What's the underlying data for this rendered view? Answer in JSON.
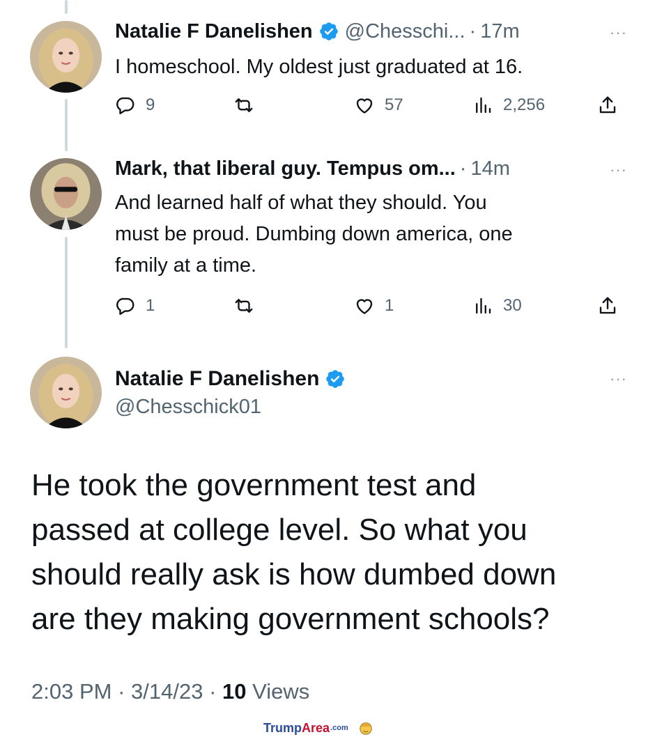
{
  "tweets": [
    {
      "name": "Natalie F Danelishen",
      "handle": "@Chesschi...",
      "separator": "·",
      "time": "17m",
      "more": "···",
      "text": "I homeschool. My oldest just graduated at 16.",
      "stats": {
        "replies": "9",
        "likes": "57",
        "views": "2,256"
      }
    },
    {
      "name": "Mark, that liberal guy. Tempus om...",
      "separator": "·",
      "time": "14m",
      "more": "···",
      "text_lines": [
        "And learned half of what they should. You",
        "must be proud. Dumbing down america, one",
        "family at a time."
      ],
      "stats": {
        "replies": "1",
        "likes": "1",
        "views": "30"
      }
    }
  ],
  "main_tweet": {
    "name": "Natalie F Danelishen",
    "handle": "@Chesschick01",
    "more": "···",
    "text_lines": [
      "He took the government test and",
      "passed at college level. So what you",
      "should really ask is how dumbed down",
      "are they making government schools?"
    ],
    "time": "2:03 PM",
    "separator": "·",
    "date": "3/14/23",
    "views_count": "10",
    "views_label": "Views"
  },
  "icons": {
    "reply": "reply-icon",
    "retweet": "retweet-icon",
    "like": "heart-icon",
    "views": "views-icon",
    "share": "share-icon",
    "verified": "verified-badge-icon"
  },
  "colors": {
    "verified_blue": "#1d9bf0",
    "muted": "#536471",
    "text": "#0f1419"
  },
  "watermark": {
    "trump": "Trump",
    "area": "Area",
    "com": ".com"
  }
}
